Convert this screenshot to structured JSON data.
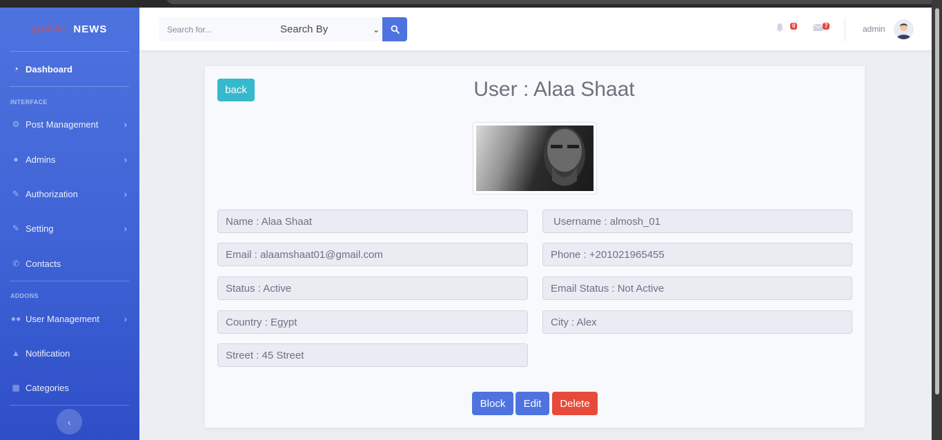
{
  "brand": {
    "logo_text": "NEWS",
    "name": "NEWS"
  },
  "sidebar": {
    "dashboard": "Dashboard",
    "interface_heading": "INTERFACE",
    "addons_heading": "ADDONS",
    "items": [
      {
        "label": "Post Management",
        "icon": "gear-icon"
      },
      {
        "label": "Admins",
        "icon": "user-icon"
      },
      {
        "label": "Authorization",
        "icon": "wrench-icon"
      },
      {
        "label": "Setting",
        "icon": "wrench-icon"
      },
      {
        "label": "Contacts",
        "icon": "phone-icon"
      },
      {
        "label": "User Management",
        "icon": "users-icon"
      },
      {
        "label": "Notification",
        "icon": "bell-icon"
      },
      {
        "label": "Categories",
        "icon": "table-icon"
      }
    ]
  },
  "topbar": {
    "search_placeholder": "Search for...",
    "search_by": "Search By",
    "notifications_count": "0",
    "messages_count": "7",
    "user_name": "admin"
  },
  "user": {
    "back_label": "back",
    "title": "User : Alaa Shaat",
    "name": "Name : Alaa Shaat",
    "username": "Username : almosh_01",
    "email": "Email : alaamshaat01@gmail.com",
    "phone": "Phone : +201021965455",
    "status": "Status : Active",
    "email_status": "Email Status : Not Active",
    "country": "Country : Egypt",
    "city": "City : Alex",
    "street": "Street : 45 Street"
  },
  "actions": {
    "block": "Block",
    "edit": "Edit",
    "delete": "Delete"
  },
  "colors": {
    "primary": "#4e73df",
    "info": "#36b9cc",
    "danger": "#e74a3b"
  }
}
